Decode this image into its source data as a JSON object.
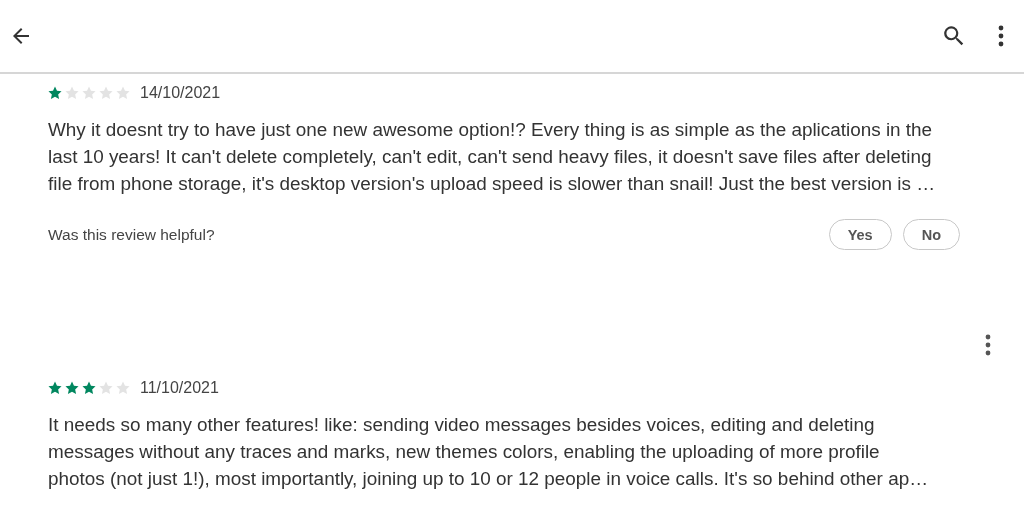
{
  "reviews": [
    {
      "stars": 1,
      "date": "14/10/2021",
      "menu": false,
      "lines": [
        "Why it doesnt try to have just one new awesome option!? Every thing is as simple as the aplications in the",
        "last 10 years! It can't delete completely, can't edit, can't send heavy files, it doesn't save files after deleting",
        "file from phone storage, it's desktop version's upload speed is slower than snail! Just the best version is …"
      ],
      "helpful": {
        "question": "Was this review helpful?",
        "buttons": [
          "Yes",
          "No"
        ]
      }
    },
    {
      "stars": 3,
      "date": "11/10/2021",
      "menu": true,
      "lines": [
        "It needs so many other features! like: sending video messages besides voices, editing and deleting",
        "messages without any traces and marks, new themes colors, enabling the uploading of more profile",
        "photos (not just 1!), most importantly, joining up to 10 or 12 people in voice calls. It's so behind other ap…"
      ]
    }
  ]
}
